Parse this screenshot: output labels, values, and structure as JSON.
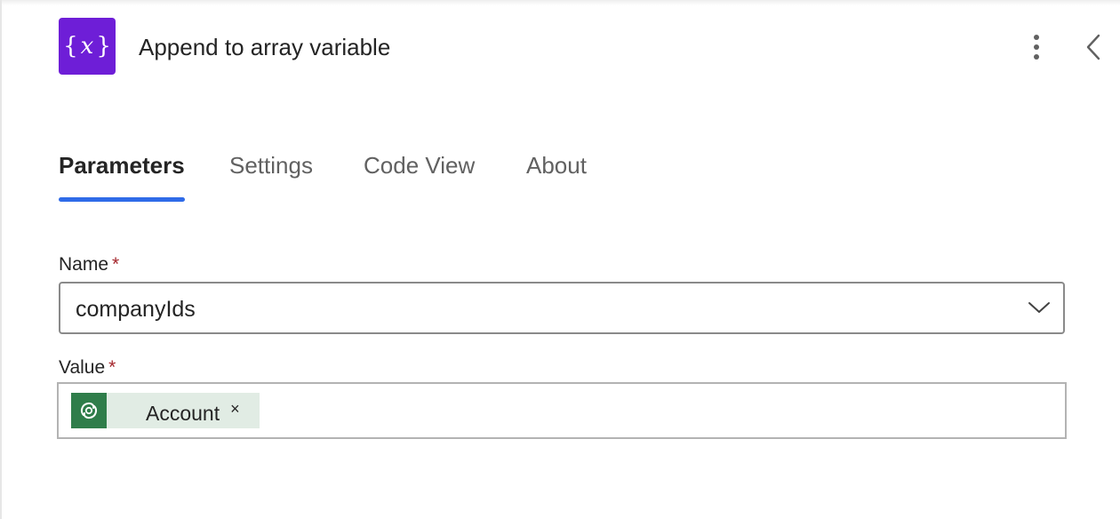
{
  "header": {
    "icon": "variable-icon",
    "icon_glyph_open": "{",
    "icon_glyph_var": "x",
    "icon_glyph_close": "}",
    "icon_color": "#6e1ed7",
    "title": "Append to array variable",
    "more_icon": "more-vertical-icon",
    "collapse_icon": "chevron-left-icon"
  },
  "tabs": [
    {
      "label": "Parameters",
      "active": true
    },
    {
      "label": "Settings",
      "active": false
    },
    {
      "label": "Code View",
      "active": false
    },
    {
      "label": "About",
      "active": false
    }
  ],
  "accent_color": "#2f6be8",
  "form": {
    "name": {
      "label": "Name",
      "required_mark": "*",
      "value": "companyIds",
      "dropdown_icon": "chevron-down-icon"
    },
    "value": {
      "label": "Value",
      "required_mark": "*",
      "tokens": [
        {
          "label": "Account",
          "icon": "dataverse-icon",
          "icon_color": "#2f7d4a",
          "remove_glyph": "×"
        }
      ]
    }
  }
}
